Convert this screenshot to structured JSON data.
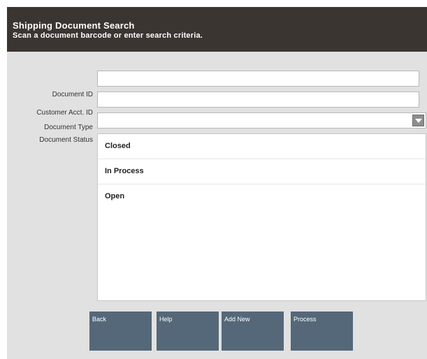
{
  "header": {
    "title": "Shipping Document Search",
    "subtitle": "Scan a document barcode or enter search criteria."
  },
  "form": {
    "document_id": {
      "label": "Document ID",
      "value": ""
    },
    "customer_acct_id": {
      "label": "Customer Acct. ID",
      "value": ""
    },
    "document_type": {
      "label": "Document Type",
      "value": ""
    },
    "document_status": {
      "label": "Document Status",
      "options": [
        "Closed",
        "In Process",
        "Open"
      ]
    }
  },
  "buttons": {
    "back": "Back",
    "help": "Help",
    "add_new": "Add New",
    "process": "Process"
  },
  "colors": {
    "header_bg": "#3b3532",
    "button_bg": "#546879",
    "panel_bg": "#e1e1e1"
  }
}
